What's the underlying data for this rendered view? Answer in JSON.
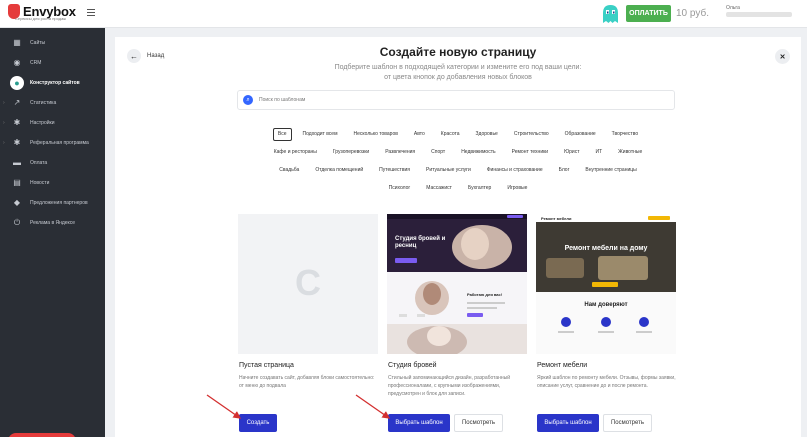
{
  "header": {
    "logo_text": "Envybox",
    "logo_subtitle": "Сервисы для роста продаж",
    "pay_button": "ОПЛАТИТЬ",
    "balance": "10 руб.",
    "user_name": "Ольга"
  },
  "sidebar": {
    "items": [
      {
        "label": "Сайты",
        "icon": "grid-icon"
      },
      {
        "label": "CRM",
        "icon": "crm-icon"
      },
      {
        "label": "Конструктор сайтов",
        "icon": "globe-icon",
        "active": true
      },
      {
        "label": "Статистика",
        "icon": "chart-icon"
      },
      {
        "label": "Настройки",
        "icon": "gear-icon"
      },
      {
        "label": "Реферальная программа",
        "icon": "gear-icon"
      },
      {
        "label": "Оплата",
        "icon": "wallet-icon"
      },
      {
        "label": "Новости",
        "icon": "news-icon"
      },
      {
        "label": "Предложения партнеров",
        "icon": "tag-icon"
      },
      {
        "label": "Реклама в Яндексе",
        "icon": "power-icon"
      }
    ]
  },
  "modal": {
    "back_label": "Назад",
    "title": "Создайте новую страницу",
    "subtitle_line1": "Подберите шаблон в подходящей категории и измените его под ваши цели:",
    "subtitle_line2": "от цвета кнопок до добавления новых блоков",
    "search_placeholder": "Поиск по шаблонам",
    "tag_rows": [
      [
        "Все",
        "Подходит всем",
        "Несколько товаров",
        "Авто",
        "Красота",
        "Здоровье",
        "Строительство",
        "Образование",
        "Творчество"
      ],
      [
        "Кафе и рестораны",
        "Грузоперевозки",
        "Развлечения",
        "Спорт",
        "Недвижимость",
        "Ремонт техники",
        "Юрист",
        "ИТ",
        "Животные"
      ],
      [
        "Свадьба",
        "Отделка помещений",
        "Путешествия",
        "Ритуальные услуги",
        "Финансы и страхование",
        "Блог",
        "Внутренние страницы"
      ],
      [
        "Психолог",
        "Массажист",
        "Бухгалтер",
        "Игровые"
      ]
    ],
    "active_tag": "Все",
    "cards": [
      {
        "title": "Пустая страница",
        "description": "Начните создавать сайт, добавляя блоки самостоятельно: от меню до подвала",
        "primary_button": "Создать",
        "thumb_letter": "C"
      },
      {
        "title": "Студия бровей",
        "description": "Стильный запоминающийся дизайн, разработанный профессионалами, с крупными изображениями, предусмотрен и блок для записи.",
        "primary_button": "Выбрать шаблон",
        "secondary_button": "Посмотреть",
        "thumb_hero_text": "Студия бровей и ресниц",
        "thumb_section_text": "Работаю для вас!"
      },
      {
        "title": "Ремонт мебели",
        "description": "Яркий шаблон по ремонту мебели. Отзывы, формы заявки, описание услуг, сравнение до и после ремонта.",
        "primary_button": "Выбрать шаблон",
        "secondary_button": "Посмотреть",
        "thumb_top_label": "Ремонт мебели",
        "thumb_hero_text": "Ремонт мебели на дому",
        "thumb_section_text": "Нам доверяют"
      }
    ]
  },
  "colors": {
    "sidebar_bg": "#2a2e35",
    "primary_button": "#2a35c9",
    "pay_button": "#4caf50",
    "logo_accent": "#e53b3b",
    "annotation_arrow": "#d32f2f"
  }
}
